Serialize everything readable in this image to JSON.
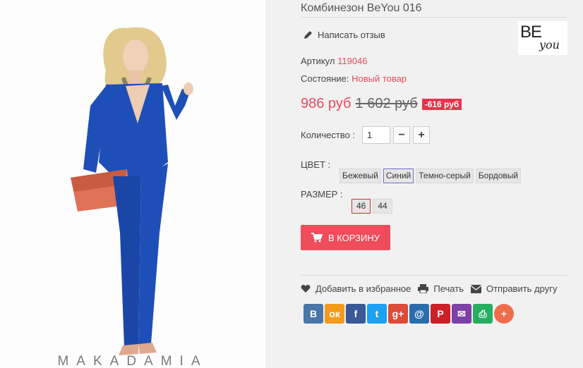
{
  "photo": {
    "watermark": "MAKADAMIA"
  },
  "product": {
    "title": "Комбинезон BeYou 016",
    "review_link": "Написать отзыв",
    "brand_logo": "BEyou",
    "sku_label": "Артикул",
    "sku_value": "119046",
    "condition_label": "Состояние:",
    "condition_value": "Новый товар",
    "price_new": "986 руб",
    "price_old": "1 602 руб",
    "discount": "-616 руб",
    "quantity_label": "Количество :",
    "quantity_value": "1",
    "minus": "−",
    "plus": "+",
    "color_label": "ЦВЕТ :",
    "colors": [
      "Бежевый",
      "Синий",
      "Темно-серый",
      "Бордовый"
    ],
    "selected_color": "Синий",
    "size_label": "РАЗМЕР :",
    "sizes": [
      "46",
      "44"
    ],
    "selected_size": "46",
    "cart_button": "В КОРЗИНУ"
  },
  "actions": {
    "favorite": "Добавить в избранное",
    "print": "Печать",
    "send": "Отправить другу"
  },
  "share": [
    {
      "icon": "vk-icon",
      "glyph": "В",
      "color": "#4a76a8"
    },
    {
      "icon": "odnoklassniki-icon",
      "glyph": "ок",
      "color": "#f59a1b"
    },
    {
      "icon": "facebook-icon",
      "glyph": "f",
      "color": "#3b5998"
    },
    {
      "icon": "twitter-icon",
      "glyph": "t",
      "color": "#1da1f2"
    },
    {
      "icon": "googleplus-icon",
      "glyph": "g+",
      "color": "#dd4b39"
    },
    {
      "icon": "mail-at-icon",
      "glyph": "@",
      "color": "#2a6dad"
    },
    {
      "icon": "pinterest-icon",
      "glyph": "P",
      "color": "#cb2027"
    },
    {
      "icon": "email-icon",
      "glyph": "✉",
      "color": "#7e3fa8"
    },
    {
      "icon": "print-icon",
      "glyph": "⎙",
      "color": "#27ae60"
    },
    {
      "icon": "more-plus-icon",
      "glyph": "+",
      "color": "#ef6c4a"
    }
  ],
  "colors": {
    "accent": "#e84a5f",
    "cart": "#ef4d5c",
    "discount": "#e8344a"
  }
}
